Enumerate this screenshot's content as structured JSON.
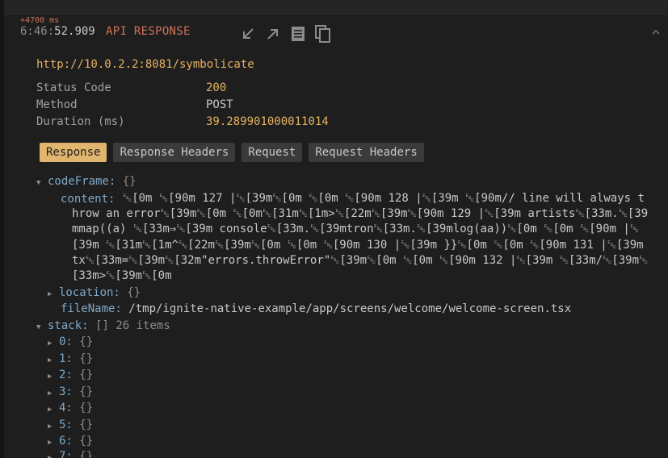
{
  "header": {
    "delta": "+4700 ms",
    "time_hm": "6:46:",
    "time_s": "52.909",
    "title": "API RESPONSE"
  },
  "request": {
    "url": "http://10.0.2.2:8081/symbolicate",
    "fields": [
      {
        "label": "Status Code",
        "value": "200"
      },
      {
        "label": "Method",
        "value": "POST"
      },
      {
        "label": "Duration (ms)",
        "value": "39.289901000011014"
      }
    ]
  },
  "tabs": [
    "Response",
    "Response Headers",
    "Request",
    "Request Headers"
  ],
  "tree": {
    "codeFrame_key": "codeFrame:",
    "codeFrame_brace": "{}",
    "content_key": "content:",
    "content_value": "␛[0m ␛[90m 127 |␛[39m␛[0m ␛[0m ␛[90m 128 |␛[39m ␛[90m// line will always throw an error␛[39m␛[0m ␛[0m␛[31m␛[1m>␛[22m␛[39m␛[90m 129 |␛[39m artists␛[33m.␛[39mmap((a) ␛[33m⇒␛[39m console␛[33m.␛[39mtron␛[33m.␛[39mlog(aa))␛[0m ␛[0m ␛[90m |␛[39m ␛[31m␛[1m^␛[22m␛[39m␛[0m ␛[0m ␛[90m 130 |␛[39m }}␛[0m ␛[0m ␛[90m 131 |␛[39m tx␛[33m=␛[39m␛[32m\"errors.throwError\"␛[39m␛[0m ␛[0m ␛[90m 132 |␛[39m ␛[33m/␛[39m␛[33m>␛[39m␛[0m",
    "location_key": "location:",
    "location_brace": "{}",
    "fileName_key": "fileName:",
    "fileName_value": "/tmp/ignite-native-example/app/screens/welcome/welcome-screen.tsx",
    "stack_key": "stack:",
    "stack_brace": "[]",
    "stack_count": "26 items",
    "stack_items": [
      {
        "key": "0:",
        "brace": "{}"
      },
      {
        "key": "1:",
        "brace": "{}"
      },
      {
        "key": "2:",
        "brace": "{}"
      },
      {
        "key": "3:",
        "brace": "{}"
      },
      {
        "key": "4:",
        "brace": "{}"
      },
      {
        "key": "5:",
        "brace": "{}"
      },
      {
        "key": "6:",
        "brace": "{}"
      },
      {
        "key": "7:",
        "brace": "{}"
      }
    ]
  },
  "icons": [
    "arrow-down-left-icon",
    "arrow-up-right-icon",
    "receipt-icon",
    "copy-icon",
    "chevron-up-icon"
  ],
  "colors": {
    "accent": "#d0735a",
    "value": "#e4b262",
    "key": "#7fa9c9",
    "active_tab": "#e0b56d"
  }
}
